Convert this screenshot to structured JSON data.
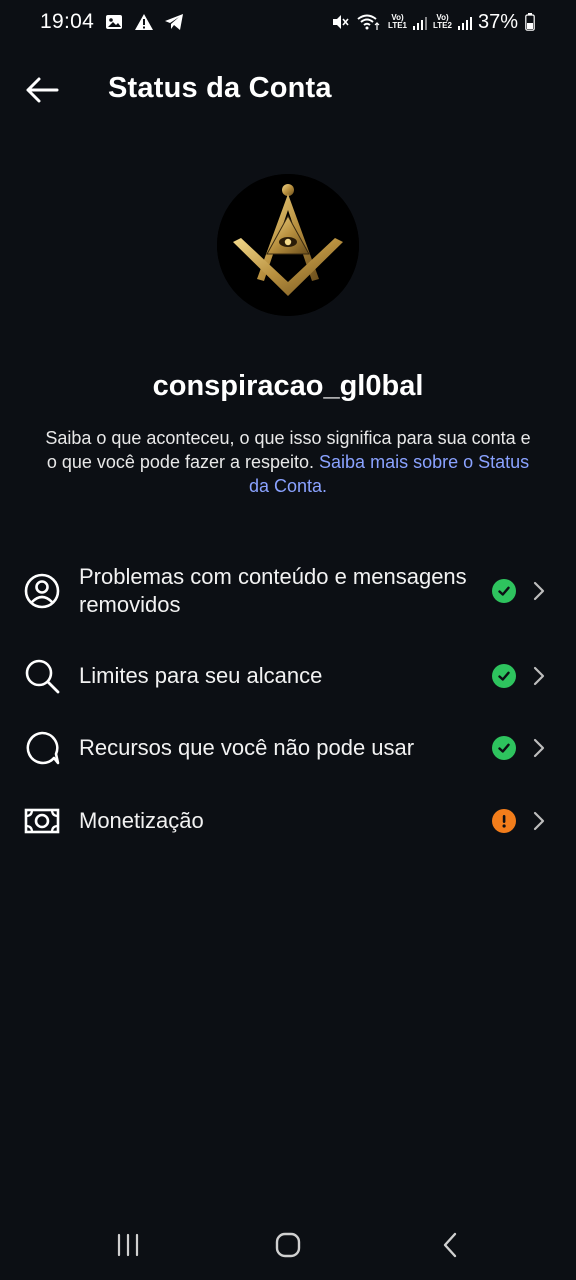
{
  "status_bar": {
    "time": "19:04",
    "battery": "37%",
    "sim1_top": "Vo)",
    "sim1_bottom": "LTE1",
    "sim2_top": "Vo)",
    "sim2_bottom": "LTE2",
    "left_icons": [
      "image-icon",
      "warning-icon",
      "telegram-icon"
    ],
    "right_icons": [
      "mute-icon",
      "wifi-icon",
      "signal-icon",
      "battery-icon"
    ]
  },
  "header": {
    "title": "Status da Conta",
    "back_icon": "arrow-left-icon"
  },
  "profile": {
    "username": "conspiracao_gl0bal",
    "description": "Saiba o que aconteceu, o que isso significa para sua conta e o que você pode fazer a respeito. ",
    "link_text": "Saiba mais sobre o Status da Conta."
  },
  "items": [
    {
      "label": "Problemas com conteúdo e mensagens removidos",
      "icon": "user-circle-icon",
      "status": "ok"
    },
    {
      "label": "Limites para seu alcance",
      "icon": "search-icon",
      "status": "ok"
    },
    {
      "label": "Recursos que você não pode usar",
      "icon": "speech-bubble-icon",
      "status": "ok"
    },
    {
      "label": "Monetização",
      "icon": "money-icon",
      "status": "warning"
    }
  ],
  "colors": {
    "background": "#0c0f14",
    "link": "#8aa2ff",
    "ok": "#2ec35e",
    "warning": "#f27d1b"
  },
  "nav": {
    "icons": [
      "recent-apps-icon",
      "home-icon",
      "back-icon"
    ]
  }
}
